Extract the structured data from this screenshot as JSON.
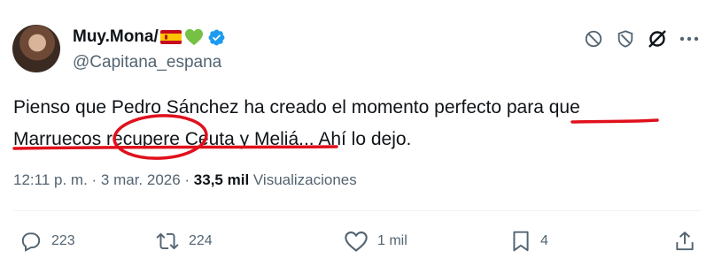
{
  "author": {
    "display_name": "Muy.Mona/",
    "handle": "@Capitana_espana",
    "flag_icon": "spain-flag-icon",
    "heart_icon": "green-heart-icon",
    "verified_icon": "verified-badge-icon"
  },
  "header_icons": [
    "mute-icon",
    "block-icon",
    "grok-icon",
    "more-icon"
  ],
  "tweet": {
    "line1": "Pienso que Pedro Sánchez ha creado el momento perfecto para que",
    "line2": "Marruecos recupere Ceuta y Meliá... Ahí lo dejo."
  },
  "meta": {
    "time": "12:11 p. m.",
    "separator": " · ",
    "date": "3 mar. 2026",
    "separator2": " · ",
    "views_count": "33,5 mil",
    "views_label": " Visualizaciones"
  },
  "actions": {
    "replies": "223",
    "reposts": "224",
    "likes": "1 mil",
    "bookmarks": "4"
  },
  "colors": {
    "text": "#0f1419",
    "secondary": "#536471",
    "verified": "#1d9bf0",
    "annotation": "#e0101c"
  }
}
